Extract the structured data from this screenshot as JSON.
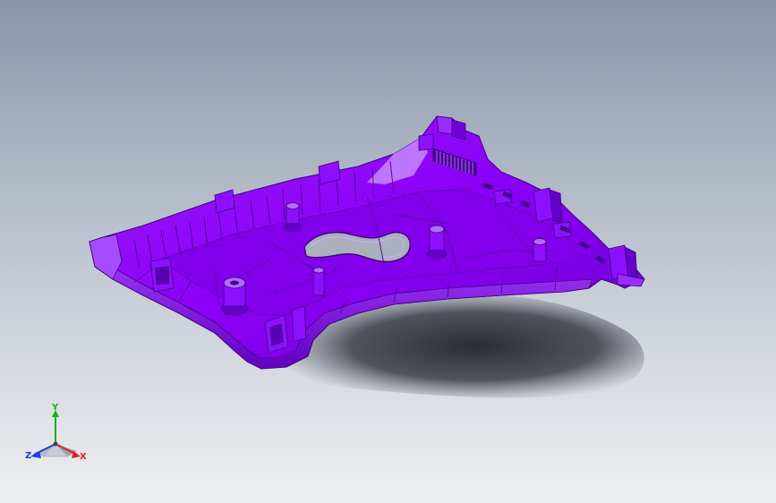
{
  "viewport": {
    "background_top": "#8996aa",
    "background_bottom": "#eeeff1",
    "part_color": "#8d00ff",
    "part_shade": "#5a00b8",
    "part_highlight": "#c07bff",
    "shadow_color": "#303238"
  },
  "triad": {
    "x_label": "X",
    "y_label": "Y",
    "z_label": "Z",
    "x_color": "#e02020",
    "y_color": "#18b018",
    "z_color": "#2040e0"
  }
}
